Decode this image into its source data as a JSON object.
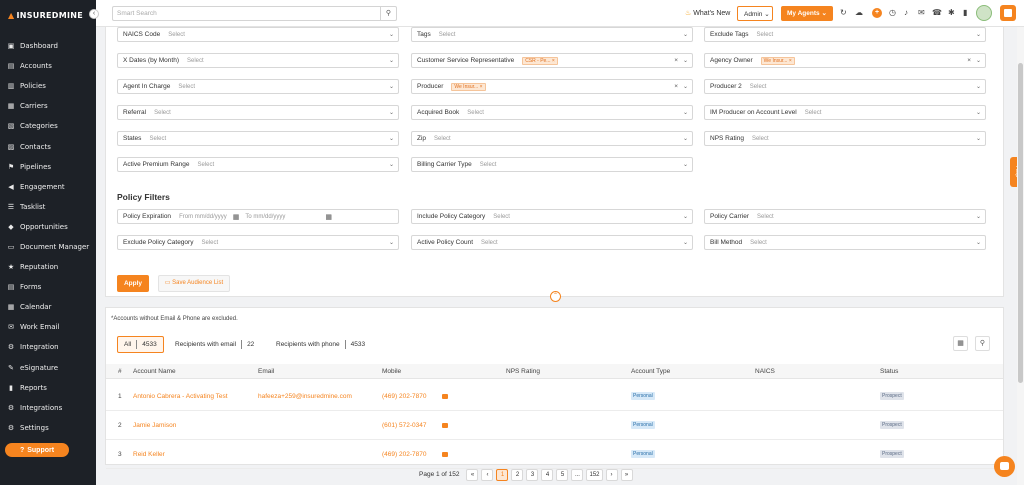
{
  "brand": {
    "logo_text": "INSUREDMINE",
    "accent": "#f5841f",
    "sidebar_bg": "#1d2127"
  },
  "sidebar": {
    "collapse_icon": "chevron-left-icon",
    "items": [
      {
        "label": "Dashboard",
        "icon": "dashboard-icon"
      },
      {
        "label": "Accounts",
        "icon": "accounts-icon"
      },
      {
        "label": "Policies",
        "icon": "policies-icon"
      },
      {
        "label": "Carriers",
        "icon": "carriers-icon"
      },
      {
        "label": "Categories",
        "icon": "categories-icon"
      },
      {
        "label": "Contacts",
        "icon": "contacts-icon"
      },
      {
        "label": "Pipelines",
        "icon": "pipelines-icon"
      },
      {
        "label": "Engagement",
        "icon": "megaphone-icon"
      },
      {
        "label": "Tasklist",
        "icon": "tasklist-icon"
      },
      {
        "label": "Opportunities",
        "icon": "opportunities-icon"
      },
      {
        "label": "Document Manager",
        "icon": "folder-icon"
      },
      {
        "label": "Reputation",
        "icon": "reputation-icon"
      },
      {
        "label": "Forms",
        "icon": "forms-icon"
      },
      {
        "label": "Calendar",
        "icon": "calendar-icon"
      },
      {
        "label": "Work Email",
        "icon": "email-icon"
      },
      {
        "label": "Integration",
        "icon": "integration-icon"
      },
      {
        "label": "eSignature",
        "icon": "signature-icon"
      },
      {
        "label": "Reports",
        "icon": "reports-icon"
      },
      {
        "label": "Integrations",
        "icon": "integrations-icon"
      },
      {
        "label": "Settings",
        "icon": "gear-icon"
      }
    ],
    "support_label": "Support"
  },
  "topbar": {
    "search_placeholder": "Smart Search",
    "whats_new": "What's New",
    "admin_label": "Admin",
    "my_agents_label": "My Agents"
  },
  "filters": {
    "rows": [
      [
        {
          "label": "NAICS Code",
          "value": "Select"
        },
        {
          "label": "Tags",
          "value": "Select"
        },
        {
          "label": "Exclude Tags",
          "value": "Select"
        }
      ],
      [
        {
          "label": "X Dates (by Month)",
          "value": "Select"
        },
        {
          "label": "Customer Service Representative",
          "tag": "CSR - Pe..."
        },
        {
          "label": "Agency Owner",
          "tag": "We Insur..."
        }
      ],
      [
        {
          "label": "Agent In Charge",
          "value": "Select"
        },
        {
          "label": "Producer",
          "tag": "We Insur..."
        },
        {
          "label": "Producer 2",
          "value": "Select"
        }
      ],
      [
        {
          "label": "Referral",
          "value": "Select"
        },
        {
          "label": "Acquired Book",
          "value": "Select"
        },
        {
          "label": "IM Producer on Account Level",
          "value": "Select"
        }
      ],
      [
        {
          "label": "States",
          "value": "Select"
        },
        {
          "label": "Zip",
          "value": "Select"
        },
        {
          "label": "NPS Rating",
          "value": "Select"
        }
      ],
      [
        {
          "label": "Active Premium Range",
          "value": "Select"
        },
        {
          "label": "Billing Carrier Type",
          "value": "Select"
        }
      ]
    ],
    "policy_title": "Policy Filters",
    "policy_expiration": {
      "label": "Policy Expiration",
      "from": "From mm/dd/yyyy",
      "to": "To mm/dd/yyyy"
    },
    "policy_rows": [
      [
        {
          "label": "Include Policy Category",
          "value": "Select"
        },
        {
          "label": "Policy Carrier",
          "value": "Select"
        }
      ],
      [
        {
          "label": "Exclude Policy Category",
          "value": "Select"
        },
        {
          "label": "Active Policy Count",
          "value": "Select"
        },
        {
          "label": "Bill Method",
          "value": "Select"
        }
      ]
    ],
    "apply_label": "Apply",
    "save_label": "Save Audience List"
  },
  "list": {
    "note": "*Accounts without Email & Phone are excluded.",
    "chips": [
      {
        "label": "All",
        "count": "4533"
      },
      {
        "label": "Recipients with email",
        "count": "22"
      },
      {
        "label": "Recipients with phone",
        "count": "4533"
      }
    ],
    "columns": [
      "#",
      "Account Name",
      "Email",
      "Mobile",
      "NPS Rating",
      "Account Type",
      "NAICS",
      "Status"
    ],
    "rows": [
      {
        "num": "1",
        "name": "Antonio Cabrera - Activating Test",
        "email": "hafeeza+259@insuredmine.com",
        "mobile": "(469) 202-7870",
        "nps": "",
        "type": "Personal",
        "naics": "",
        "status": "Prospect"
      },
      {
        "num": "2",
        "name": "Jamie Jamison",
        "email": "",
        "mobile": "(601) 572-0347",
        "nps": "",
        "type": "Personal",
        "naics": "",
        "status": "Prospect"
      },
      {
        "num": "3",
        "name": "Reid Keller",
        "email": "",
        "mobile": "(469) 202-7870",
        "nps": "",
        "type": "Personal",
        "naics": "",
        "status": "Prospect"
      }
    ]
  },
  "pagination": {
    "label": "Page 1 of 152",
    "pages": [
      "«",
      "‹",
      "1",
      "2",
      "3",
      "4",
      "5",
      "...",
      "152",
      "›",
      "»"
    ],
    "current": "1"
  },
  "help_label": "Help"
}
